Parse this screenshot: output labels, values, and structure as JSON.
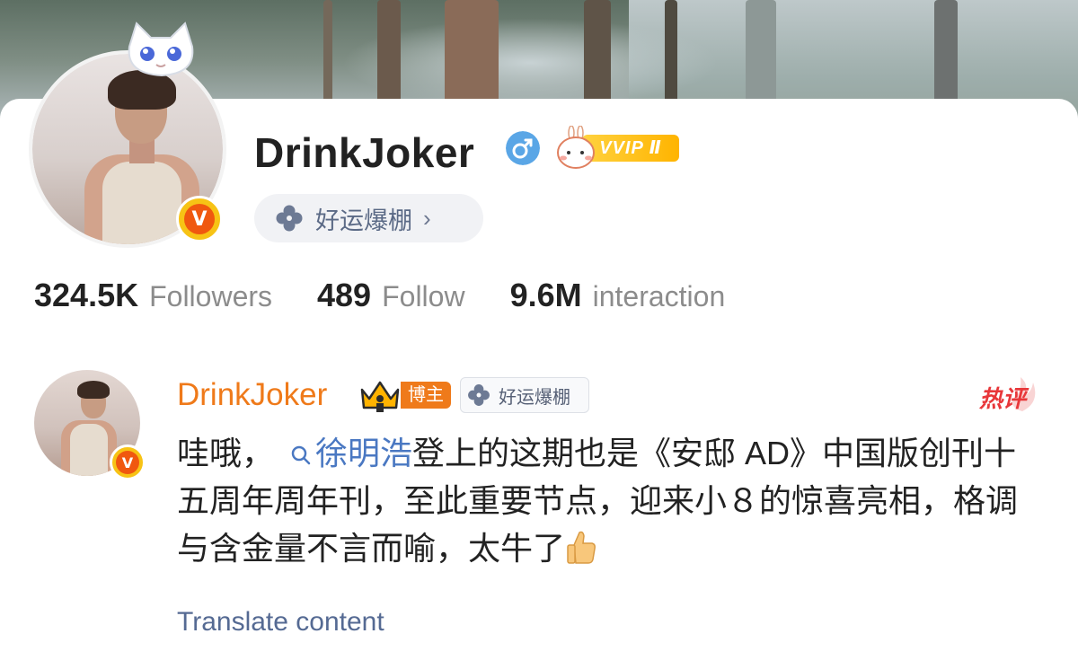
{
  "profile": {
    "username": "DrinkJoker",
    "gender": "male",
    "verified_badge": "V",
    "vip_label": "VVIP Ⅱ",
    "luck_label": "好运爆棚",
    "luck_chevron": "›"
  },
  "stats": [
    {
      "value": "324.5K",
      "label": "Followers"
    },
    {
      "value": "489",
      "label": "Follow"
    },
    {
      "value": "9.6M",
      "label": "interaction"
    }
  ],
  "comment": {
    "author": "DrinkJoker",
    "role_badge": "博主",
    "luck_badge": "好运爆棚",
    "hot_label": "热评",
    "text_before": "哇哦，",
    "mention": "徐明浩",
    "text_after": "登上的这期也是《安邸 AD》中国版创刊十五周年周年刊，至此重要节点，迎来小８的惊喜亮相，格调与含金量不言而喻，太牛了",
    "emoji": "thumbs-up",
    "translate_link": "Translate content"
  },
  "colors": {
    "accent_orange": "#ef7a1a",
    "link_blue": "#4a78c2",
    "hot_red": "#e8373a",
    "vip_gold": "#ffc21a"
  }
}
